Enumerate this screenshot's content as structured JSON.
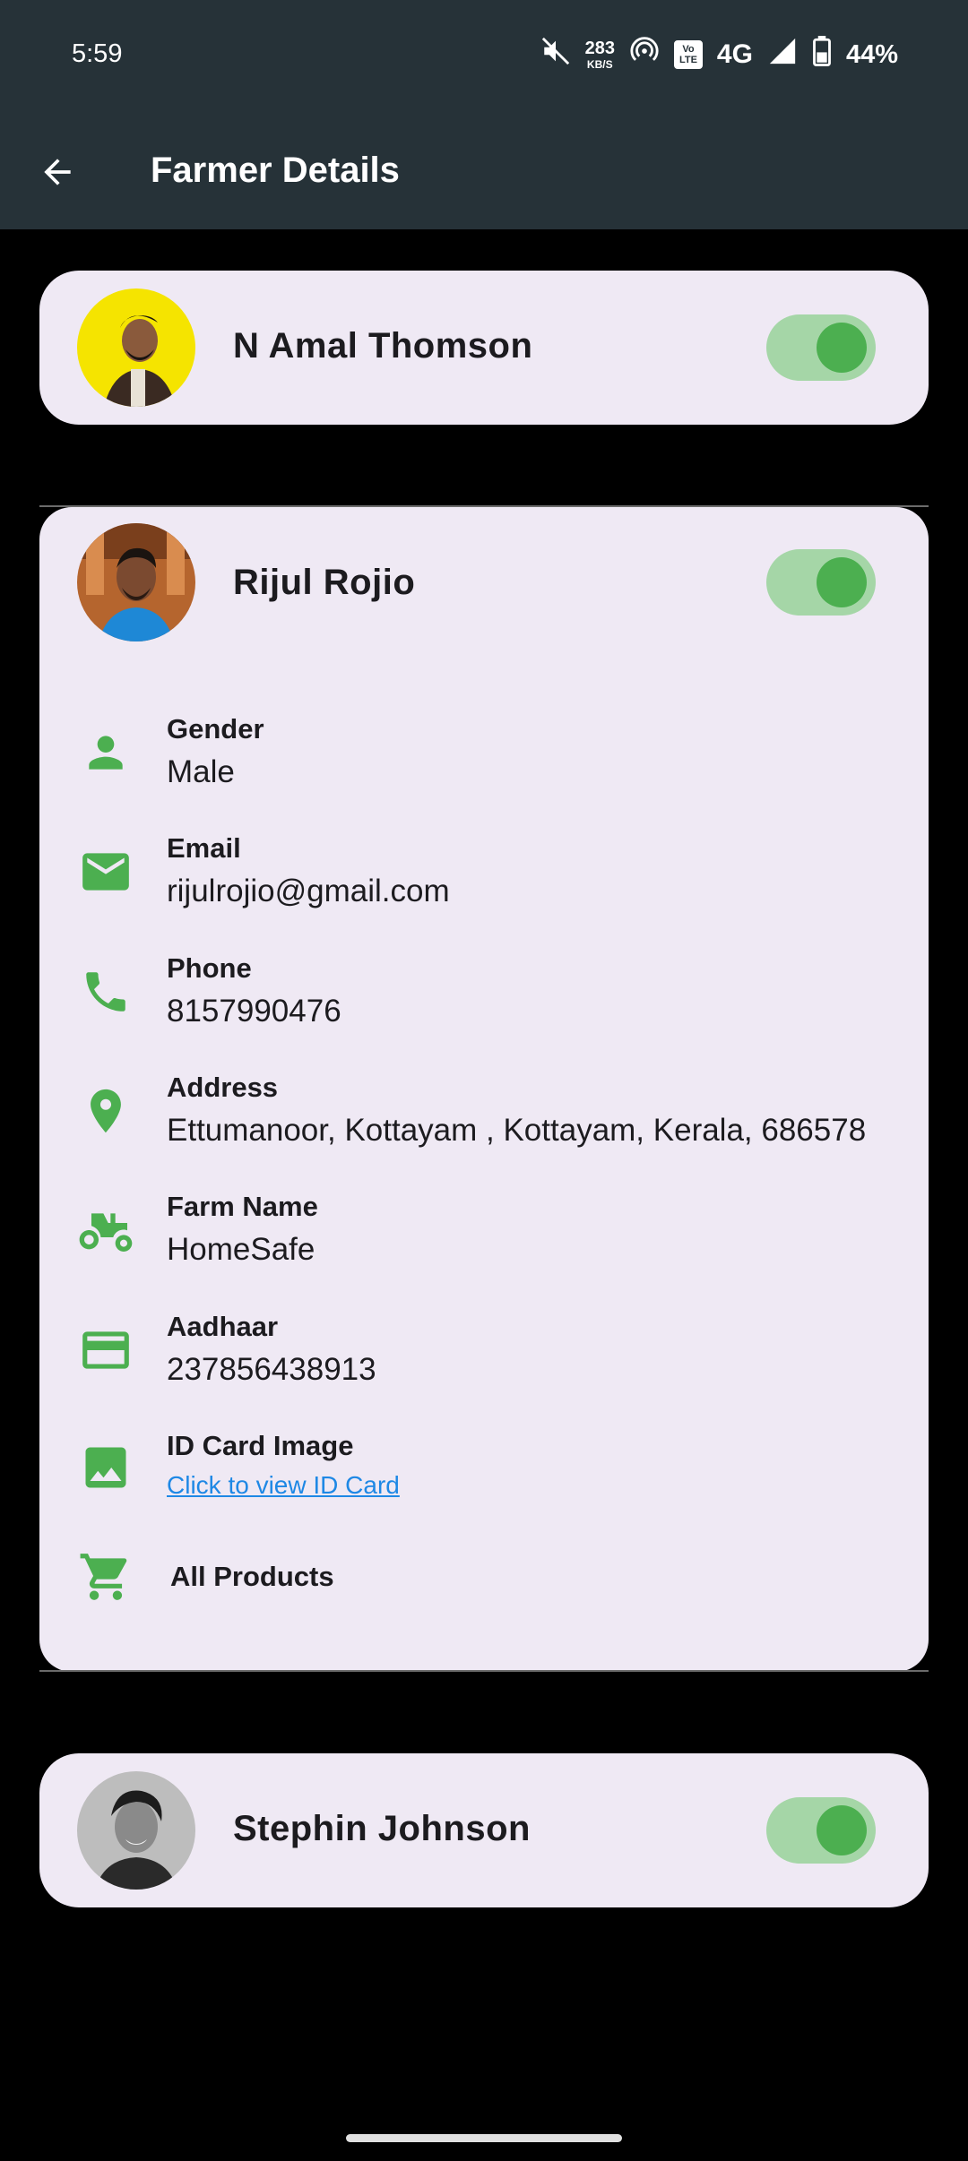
{
  "status_bar": {
    "time": "5:59",
    "speed_value": "283",
    "speed_unit": "KB/S",
    "volte_top": "Vo",
    "volte_bottom": "LTE",
    "network": "4G",
    "battery": "44%"
  },
  "app_bar": {
    "title": "Farmer Details",
    "back_icon": "arrow-back-icon"
  },
  "farmers": [
    {
      "name": "N Amal Thomson",
      "enabled": true,
      "avatar_bg": "#f5e400"
    },
    {
      "name": "Rijul Rojio",
      "enabled": true,
      "avatar_bg": "#c0733a",
      "details": {
        "gender_label": "Gender",
        "gender_value": "Male",
        "email_label": "Email",
        "email_value": "rijulrojio@gmail.com",
        "phone_label": "Phone",
        "phone_value": "8157990476",
        "address_label": "Address",
        "address_value": "Ettumanoor, Kottayam , Kottayam, Kerala, 686578",
        "farm_label": "Farm Name",
        "farm_value": "HomeSafe",
        "aadhaar_label": "Aadhaar",
        "aadhaar_value": "237856438913",
        "id_card_label": "ID Card Image",
        "id_card_link": "Click to view ID Card",
        "products_label": "All Products"
      }
    },
    {
      "name": "Stephin Johnson",
      "enabled": true,
      "avatar_bg": "#9e9e9e"
    }
  ],
  "colors": {
    "accent_green": "#4caf50",
    "toggle_track": "#a5d6a7",
    "card_bg": "#efe9f4",
    "appbar_bg": "#263238",
    "link_blue": "#1e88e5"
  }
}
